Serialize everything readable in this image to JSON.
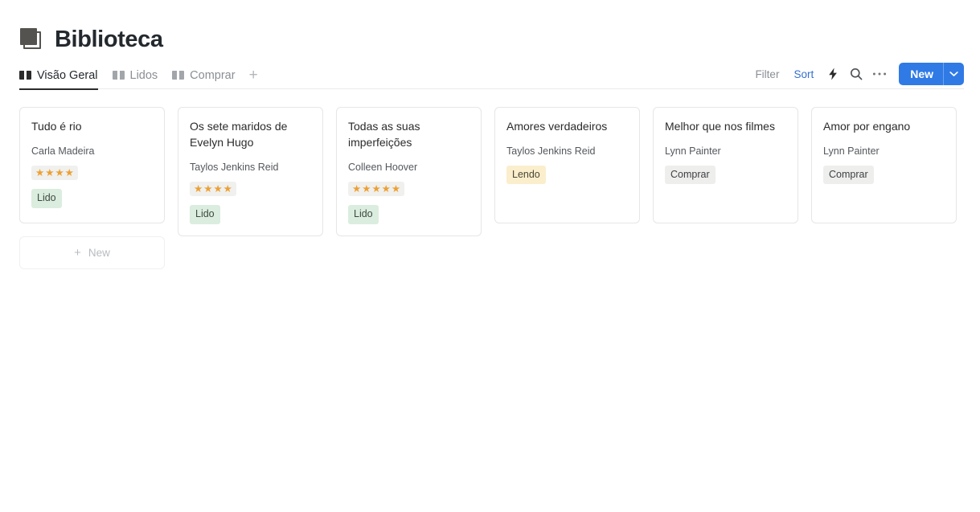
{
  "header": {
    "title": "Biblioteca",
    "icon": "closed-book-icon"
  },
  "tabs": [
    {
      "label": "Visão Geral",
      "icon": "open-book-icon",
      "active": true
    },
    {
      "label": "Lidos",
      "icon": "open-book-icon",
      "active": false
    },
    {
      "label": "Comprar",
      "icon": "open-book-icon",
      "active": false
    }
  ],
  "tab_add": {
    "label": "+",
    "icon": "plus-icon"
  },
  "toolbar": {
    "filter_label": "Filter",
    "sort_label": "Sort",
    "lightning_icon": "lightning-bolt-icon",
    "search_icon": "search-icon",
    "more_icon": "ellipsis-icon",
    "new_label": "New",
    "new_chevron_icon": "chevron-down-icon",
    "accent_color": "#2f7ae5",
    "sort_color": "#3470cf"
  },
  "board": {
    "new_card": {
      "label": "New",
      "icon": "plus-icon"
    },
    "cards": [
      {
        "title": "Tudo é rio",
        "author": "Carla Madeira",
        "rating": 4,
        "status": "Lido",
        "status_color": "green"
      },
      {
        "title": "Os sete maridos de Evelyn Hugo",
        "author": "Taylos Jenkins Reid",
        "rating": 4,
        "status": "Lido",
        "status_color": "green"
      },
      {
        "title": "Todas as suas imperfeições",
        "author": "Colleen Hoover",
        "rating": 5,
        "status": "Lido",
        "status_color": "green"
      },
      {
        "title": "Amores verdadeiros",
        "author": "Taylos Jenkins Reid",
        "rating": 0,
        "status": "Lendo",
        "status_color": "yellow"
      },
      {
        "title": "Melhor que nos filmes",
        "author": "Lynn Painter",
        "rating": 0,
        "status": "Comprar",
        "status_color": "gray"
      },
      {
        "title": "Amor por engano",
        "author": "Lynn Painter",
        "rating": 0,
        "status": "Comprar",
        "status_color": "gray"
      }
    ]
  },
  "colors": {
    "star": "#eda033",
    "badge_green_bg": "#dbedde",
    "badge_yellow_bg": "#faeecd",
    "badge_gray_bg": "#eeeeec",
    "card_border": "#e6e6e6",
    "title_text": "#24292e"
  }
}
